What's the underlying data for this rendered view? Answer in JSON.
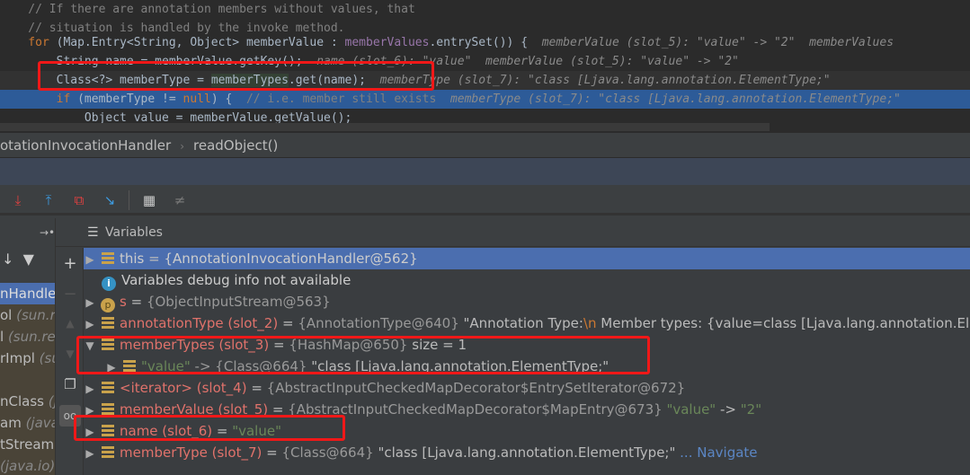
{
  "editor": {
    "lines": [
      {
        "code": "    // If there are annotation members without values, that"
      },
      {
        "code": "    // situation is handled by the invoke method."
      },
      {
        "kw": "    for ",
        "code": "(Map.Entry<String, Object> memberValue : ",
        "pu": "memberValues",
        ".rest": "",
        "rest": ".entrySet()) {  ",
        "dbg": "memberValue (slot_5): \"value\" -> \"2\"  memberValues"
      },
      {
        "code": "        String name = memberValue.getKey();  ",
        "dbg": "name (slot_6): \"value\"  memberValue (slot_5): \"value\" -> \"2\""
      },
      {
        "code": "        Class<?> memberType = ",
        "mt": "memberTypes",
        "rest": ".get(name);",
        "dbg": "  memberType (slot_7): \"class [Ljava.lang.annotation.ElementType;\""
      },
      {
        "kw": "        if ",
        "code": "(memberType != ",
        "kw2": "null",
        "rest": ") {  ",
        "cm": "// i.e. member still exists  ",
        "dbg": "memberType (slot_7): \"class [Ljava.lang.annotation.ElementType;\""
      },
      {
        "code": "            Object value = memberValue.getValue();"
      }
    ]
  },
  "breadcrumb": {
    "items": [
      "otationInvocationHandler",
      "readObject()"
    ],
    "separator": "›"
  },
  "toolbar": {
    "icons": [
      "step-into-icon",
      "step-out-icon",
      "drop-frame-icon",
      "run-to-cursor-icon",
      "evaluate-expression-icon",
      "trace-icon"
    ]
  },
  "frames": {
    "items": [
      {
        "name": "nHandler",
        "pkg": "",
        "selected": true
      },
      {
        "name": "ol ",
        "pkg": "(sun.re"
      },
      {
        "name": "l ",
        "pkg": "(sun.re"
      },
      {
        "name": "rImpl ",
        "pkg": "(su"
      },
      {
        "name": "",
        "pkg": ""
      },
      {
        "name": "nClass ",
        "pkg": "(ja"
      },
      {
        "name": "am ",
        "pkg": "(java.i"
      },
      {
        "name": "tStream ",
        "pkg": "("
      },
      {
        "name": "",
        "pkg": "(java.io)"
      }
    ]
  },
  "variables": {
    "title": "Variables",
    "rows": [
      {
        "arrow": "▶",
        "icon": "field",
        "name": "this",
        "eq": " = ",
        "obj": "{AnnotationInvocationHandler@562}",
        "selected": true
      },
      {
        "arrow": "",
        "icon": "info",
        "name": "Variables debug info not available",
        "plain": true
      },
      {
        "arrow": "▶",
        "icon": "param",
        "name": "s",
        "eq": " = ",
        "obj": "{ObjectInputStream@563}"
      },
      {
        "arrow": "▶",
        "icon": "field",
        "name": "annotationType (slot_2)",
        "eq": " = ",
        "obj": "{AnnotationType@640}",
        "val": " \"Annotation Type:",
        "esc": "\\n",
        "val2": "   Member types: {value=class [Ljava.lang.annotation.ElementType;}"
      },
      {
        "arrow": "▼",
        "icon": "field",
        "name": "memberTypes (slot_3)",
        "eq": " = ",
        "obj": "{HashMap@650}",
        "val": "  size = 1"
      },
      {
        "arrow": "▶",
        "icon": "field",
        "indent": true,
        "str": "\"value\"",
        "obj": " -> {Class@664}",
        "val": " \"class [Ljava.lang.annotation.ElementType;\""
      },
      {
        "arrow": "▶",
        "icon": "field",
        "name": "<iterator> (slot_4)",
        "eq": " = ",
        "obj": "{AbstractInputCheckedMapDecorator$EntrySetIterator@672}"
      },
      {
        "arrow": "▶",
        "icon": "field",
        "name": "memberValue (slot_5)",
        "eq": " = ",
        "obj": "{AbstractInputCheckedMapDecorator$MapEntry@673}",
        "str": " \"value\"",
        "val": " -> ",
        "str2": "\"2\""
      },
      {
        "arrow": "▶",
        "icon": "field",
        "name": "name (slot_6)",
        "eq": " = ",
        "str": "\"value\""
      },
      {
        "arrow": "▶",
        "icon": "field",
        "name": "memberType (slot_7)",
        "eq": " = ",
        "obj": "{Class@664}",
        "val": " \"class [Ljava.lang.annotation.ElementType;\"",
        "nav": " ... Navigate"
      }
    ]
  },
  "colors": {
    "highlight": "#2d5b98",
    "selection": "#4b6eaf",
    "annotation_box": "#f01818"
  }
}
